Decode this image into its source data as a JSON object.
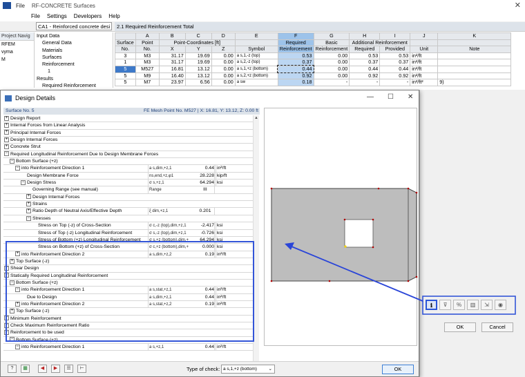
{
  "window": {
    "file_menu": "File",
    "title": "RF-CONCRETE Surfaces",
    "close": "✕"
  },
  "menubar": [
    "File",
    "Settings",
    "Developers",
    "Help"
  ],
  "case_select": "CA1 - Reinforced concrete desi",
  "panel_title": "2.1 Required Reinforcement Total",
  "navigator": {
    "header": "Project Navig",
    "root": "RFEM",
    "item": "vyma",
    "sub": "M"
  },
  "tree_nav": [
    "Input Data",
    "General Data",
    "Materials",
    "Surfaces",
    "Reinforcement",
    "1",
    "Results",
    "Required Reinforcement"
  ],
  "grid": {
    "col_letters": [
      "A",
      "B",
      "C",
      "D",
      "E",
      "F",
      "G",
      "H",
      "I",
      "J",
      "K"
    ],
    "head1": [
      "Surface",
      "Point",
      "Point-Coordinates [ft]",
      "",
      "",
      "",
      "Required",
      "Basic",
      "Additional Reinforcement",
      "",
      "",
      ""
    ],
    "head2": [
      "No.",
      "No.",
      "X",
      "Y",
      "Z",
      "Symbol",
      "Reinforcement",
      "Reinforcement",
      "Required",
      "Provided",
      "Unit",
      "Note"
    ],
    "rows": [
      {
        "s": "3",
        "p": "M3",
        "x": "31.17",
        "y": "19.69",
        "z": "0.00",
        "sym": "a s,1,-z (top)",
        "req": "0.53",
        "basic": "0.00",
        "areq": "0.53",
        "aprov": "0.53",
        "unit": "in²/ft",
        "note": ""
      },
      {
        "s": "1",
        "p": "M3",
        "x": "31.17",
        "y": "19.69",
        "z": "0.00",
        "sym": "a s,2,-z (top)",
        "req": "0.37",
        "basic": "0.00",
        "areq": "0.37",
        "aprov": "0.37",
        "unit": "in²/ft",
        "note": ""
      },
      {
        "s": "5",
        "p": "M527",
        "x": "16.81",
        "y": "13.12",
        "z": "0.00",
        "sym": "a s,1,+z (bottom)",
        "req": "0.44",
        "basic": "0.00",
        "areq": "0.44",
        "aprov": "0.44",
        "unit": "in²/ft",
        "note": ""
      },
      {
        "s": "5",
        "p": "M9",
        "x": "16.40",
        "y": "13.12",
        "z": "0.00",
        "sym": "a s,2,+z (bottom)",
        "req": "0.92",
        "basic": "0.00",
        "areq": "0.92",
        "aprov": "0.92",
        "unit": "in²/ft",
        "note": ""
      },
      {
        "s": "5",
        "p": "M7",
        "x": "23.97",
        "y": "6.56",
        "z": "0.00",
        "sym": "a sw",
        "req": "0.18",
        "basic": "-",
        "areq": "-",
        "aprov": "-",
        "unit": "in²/ft²",
        "note": "9)"
      }
    ]
  },
  "dialog": {
    "title": "Design Details",
    "header_left": "Surface No. 5",
    "header_right": "FE Mesh Point No. M527  |  X: 16.81, Y: 13.12, Z: 0.00 ft",
    "footer": {
      "type_label": "Type of check:",
      "type_value": "a s,1,+z (bottom)",
      "ok": "OK"
    },
    "rows": [
      {
        "lvl": 0,
        "exp": "+",
        "label": "Design Report",
        "sym": "",
        "val": "",
        "unit": ""
      },
      {
        "lvl": 0,
        "exp": "+",
        "label": "Internal Forces from Linear Analysis",
        "sym": "",
        "val": "",
        "unit": ""
      },
      {
        "lvl": 0,
        "exp": "+",
        "label": "Principal Internal Forces",
        "sym": "",
        "val": "",
        "unit": ""
      },
      {
        "lvl": 0,
        "exp": "+",
        "label": "Design Internal Forces",
        "sym": "",
        "val": "",
        "unit": ""
      },
      {
        "lvl": 0,
        "exp": "+",
        "label": "Concrete Strut",
        "sym": "",
        "val": "",
        "unit": ""
      },
      {
        "lvl": 0,
        "exp": "−",
        "label": "Required Longitudinal Reinforcement Due to Design Membrane Forces",
        "sym": "",
        "val": "",
        "unit": ""
      },
      {
        "lvl": 1,
        "exp": "−",
        "label": "Bottom Surface (+z)",
        "sym": "",
        "val": "",
        "unit": ""
      },
      {
        "lvl": 2,
        "exp": "−",
        "label": "into Reinforcement Direction 1",
        "sym": "a s,dim,+z,1",
        "val": "0.44",
        "unit": "in²/ft"
      },
      {
        "lvl": 3,
        "exp": "",
        "label": "Design Membrane Force",
        "sym": "ns,end,+z,φ1",
        "val": "28.228",
        "unit": "kip/ft"
      },
      {
        "lvl": 3,
        "exp": "−",
        "label": "Design Stress",
        "sym": "σ s,+z,1",
        "val": "64.294",
        "unit": "ksi"
      },
      {
        "lvl": 4,
        "exp": "",
        "label": "Governing Range (see manual)",
        "sym": "Range",
        "val": "III",
        "unit": "",
        "cval": true
      },
      {
        "lvl": 4,
        "exp": "+",
        "label": "Design Internal Forces",
        "sym": "",
        "val": "",
        "unit": ""
      },
      {
        "lvl": 4,
        "exp": "+",
        "label": "Strains",
        "sym": "",
        "val": "",
        "unit": ""
      },
      {
        "lvl": 4,
        "exp": "+",
        "label": "Ratio Depth of Neutral Axis/Effective Depth",
        "sym": "ξ dim,+z,1",
        "val": "0.201",
        "unit": "",
        "cval": true
      },
      {
        "lvl": 4,
        "exp": "−",
        "label": "Stresses",
        "sym": "",
        "val": "",
        "unit": ""
      },
      {
        "lvl": 5,
        "exp": "",
        "label": "Stress on Top (-z) of Cross-Section",
        "sym": "σ c,-z (top),dim,+z,1",
        "val": "-2.417",
        "unit": "ksi"
      },
      {
        "lvl": 5,
        "exp": "",
        "label": "Stress of Top (-z) Longitudinal Reinforcement",
        "sym": "σ s,-z (top),dim,+z,1",
        "val": "-0.726",
        "unit": "ksi"
      },
      {
        "lvl": 5,
        "exp": "",
        "label": "Stress of Bottom (+z) Longitudinal Reinforcement",
        "sym": "σ s,+z (bottom),dim,+",
        "val": "64.294",
        "unit": "ksi"
      },
      {
        "lvl": 5,
        "exp": "",
        "label": "Stress on Bottom (+z) of Cross-Section",
        "sym": "σ c,+z (bottom),dim,+",
        "val": "0.000",
        "unit": "ksi"
      },
      {
        "lvl": 2,
        "exp": "+",
        "label": "into Reinforcement Direction 2",
        "sym": "a s,dim,+z,2",
        "val": "0.19",
        "unit": "in²/ft"
      },
      {
        "lvl": 1,
        "exp": "+",
        "label": "Top Surface (-z)",
        "sym": "",
        "val": "",
        "unit": ""
      },
      {
        "lvl": 0,
        "exp": "+",
        "label": "Shear Design",
        "sym": "",
        "val": "",
        "unit": ""
      },
      {
        "lvl": 0,
        "exp": "−",
        "label": "Statically Required Longitudinal Reinforcement",
        "sym": "",
        "val": "",
        "unit": ""
      },
      {
        "lvl": 1,
        "exp": "−",
        "label": "Bottom Surface (+z)",
        "sym": "",
        "val": "",
        "unit": ""
      },
      {
        "lvl": 2,
        "exp": "−",
        "label": "into Reinforcement Direction 1",
        "sym": "a s,stat,+z,1",
        "val": "0.44",
        "unit": "in²/ft"
      },
      {
        "lvl": 3,
        "exp": "",
        "label": "Due to Design",
        "sym": "a s,dim,+z,1",
        "val": "0.44",
        "unit": "in²/ft"
      },
      {
        "lvl": 2,
        "exp": "+",
        "label": "into Reinforcement Direction 2",
        "sym": "a s,stat,+z,2",
        "val": "0.19",
        "unit": "in²/ft"
      },
      {
        "lvl": 1,
        "exp": "+",
        "label": "Top Surface (-z)",
        "sym": "",
        "val": "",
        "unit": ""
      },
      {
        "lvl": 0,
        "exp": "+",
        "label": "Minimum Reinforcement",
        "sym": "",
        "val": "",
        "unit": ""
      },
      {
        "lvl": 0,
        "exp": "+",
        "label": "Check Maximum Reinforcement Ratio",
        "sym": "",
        "val": "",
        "unit": ""
      },
      {
        "lvl": 0,
        "exp": "−",
        "label": "Reinforcement to be used",
        "sym": "",
        "val": "",
        "unit": ""
      },
      {
        "lvl": 1,
        "exp": "−",
        "label": "Bottom Surface (+z)",
        "sym": "",
        "val": "",
        "unit": ""
      },
      {
        "lvl": 2,
        "exp": "−",
        "label": "into Reinforcement Direction 1",
        "sym": "a s,+z,1",
        "val": "0.44",
        "unit": "in²/ft"
      }
    ]
  },
  "right_panel": {
    "ok": "OK",
    "cancel": "Cancel",
    "icons": [
      "info-icon",
      "filter-icon",
      "percent-icon",
      "bar-chart-icon",
      "export-icon",
      "eye-icon"
    ]
  },
  "colors": {
    "highlight": "#3355d8",
    "selection": "#3d79c9",
    "preview_surface": "#bdbdbd"
  }
}
